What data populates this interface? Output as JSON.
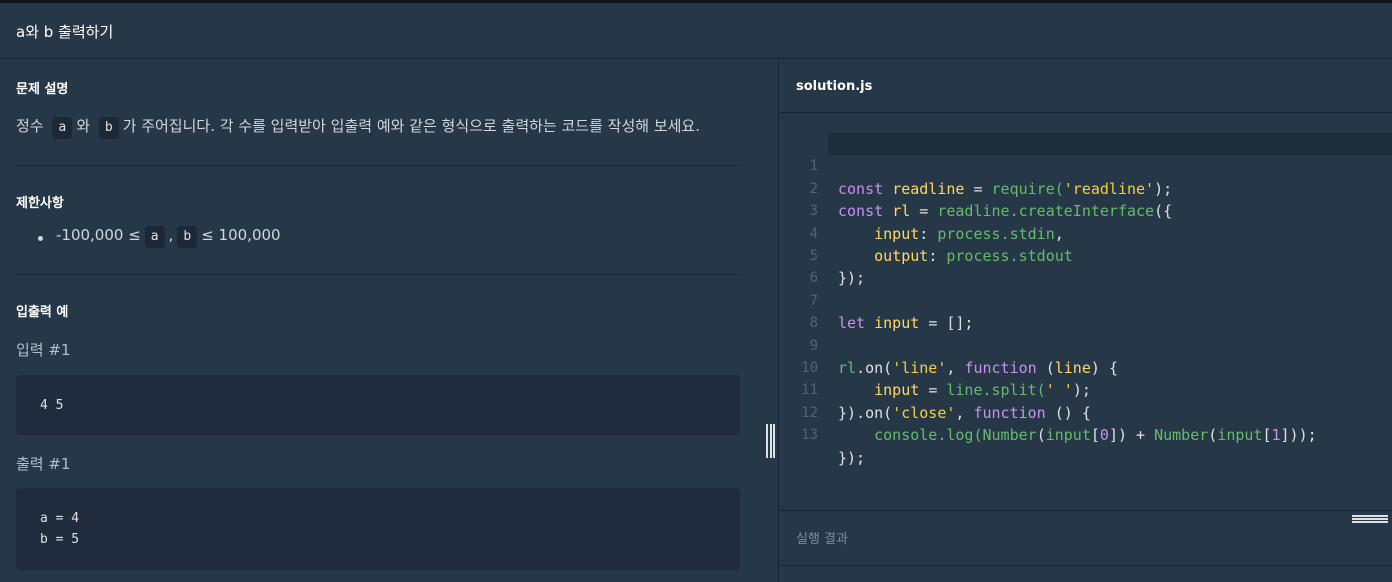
{
  "header": {
    "title": "a와 b 출력하기"
  },
  "problem": {
    "description_heading": "문제 설명",
    "description_parts": [
      "정수",
      "a",
      "와",
      "b",
      "가 주어집니다. 각 수를 입력받아 입출력 예와 같은 형식으로 출력하는 코드를 작성해 보세요."
    ],
    "constraints_heading": "제한사항",
    "constraint_parts": [
      "-100,000 ≤",
      "a",
      ",",
      "b",
      "≤ 100,000"
    ],
    "io_heading": "입출력 예",
    "input_label": "입력 #1",
    "input_value": "4 5",
    "output_label": "출력 #1",
    "output_lines": [
      "a = 4",
      "b = 5"
    ]
  },
  "editor": {
    "filename": "solution.js",
    "line_numbers": [
      "1",
      "2",
      "3",
      "4",
      "5",
      "6",
      "7",
      "8",
      "9",
      "10",
      "11",
      "12",
      "13"
    ],
    "result_label": "실행 결과"
  },
  "code": {
    "l1": [
      "const",
      "readline",
      "=",
      "require(",
      "'readline'",
      ");"
    ],
    "l2": [
      "const",
      "rl",
      "=",
      "readline",
      ".createInterface",
      "({"
    ],
    "l3": [
      "input",
      ":",
      "process",
      ".stdin",
      ","
    ],
    "l4": [
      "output",
      ":",
      "process",
      ".stdout"
    ],
    "l5": [
      "});"
    ],
    "l7": [
      "let",
      "input",
      "=",
      "[];"
    ],
    "l9": [
      "rl",
      ".on(",
      "'line'",
      ",",
      "function",
      "(",
      "line",
      ")",
      "{"
    ],
    "l10": [
      "input",
      "=",
      "line",
      ".split(",
      "' '",
      ");"
    ],
    "l11": [
      "})",
      ".on(",
      "'close'",
      ",",
      "function",
      "()",
      "{"
    ],
    "l12": [
      "console",
      ".log(",
      "Number",
      "(",
      "input",
      "[",
      "0",
      "])",
      "+",
      "Number",
      "(",
      "input",
      "[",
      "1",
      "]));"
    ],
    "l13": [
      "});"
    ]
  },
  "colors": {
    "background": "#263747",
    "keyword": "#c792ea",
    "variable": "#ffd866",
    "function": "#66bb6a",
    "string": "#f4d03f"
  }
}
